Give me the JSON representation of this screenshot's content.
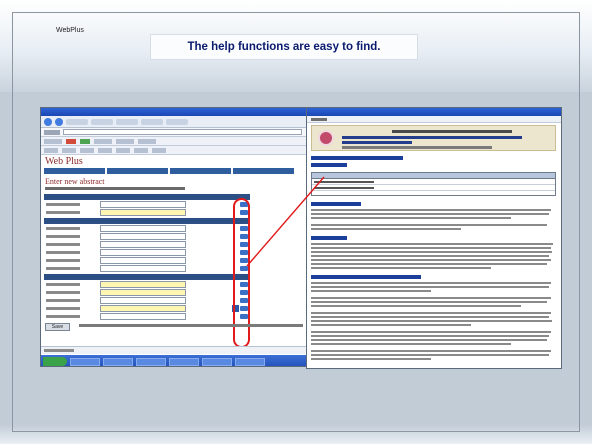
{
  "slide": {
    "brand": "WebPlus",
    "headline": "The help functions are easy to find."
  },
  "left_screenshot": {
    "app": "",
    "logo": "Web Plus",
    "form_title": "Enter new abstract",
    "save_label": "Save"
  },
  "right_screenshot": {
    "app": "",
    "heading": ""
  },
  "colors": {
    "headline": "#0a1a6e",
    "annotation": "#e11b1b",
    "slide_bg": "#c2ccd6",
    "logo": "#8c2a2a"
  },
  "icons": [
    "help-icon",
    "dropdown-icon",
    "seal-icon",
    "start-icon"
  ]
}
